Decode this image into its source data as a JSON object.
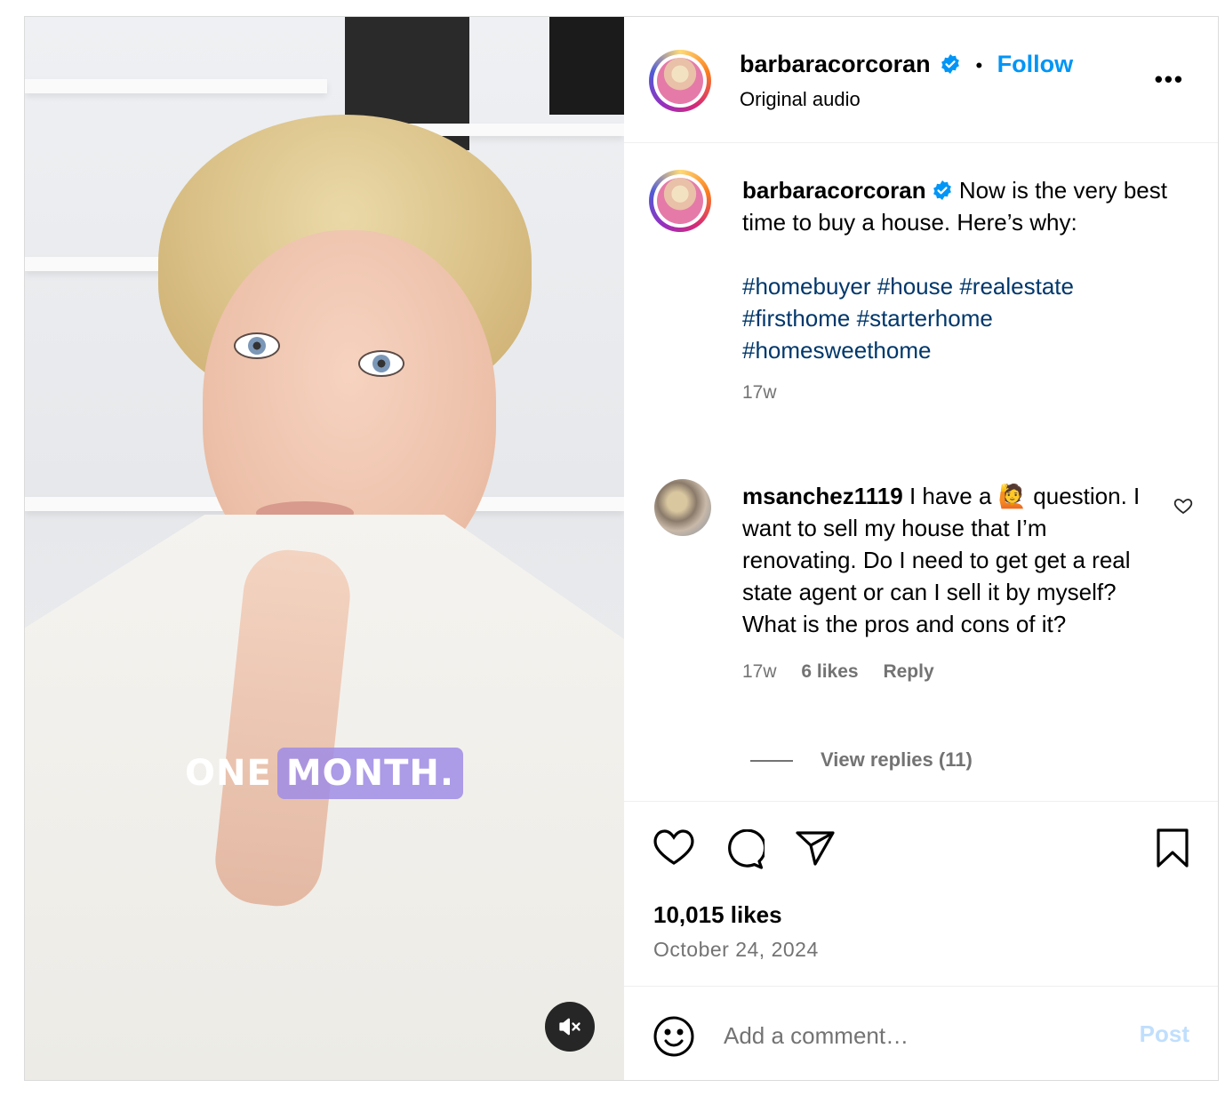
{
  "video": {
    "caption_plain": "ONE",
    "caption_highlight": "MONTH.",
    "mute_icon": "volume-muted-icon"
  },
  "header": {
    "username": "barbaracorcoran",
    "verified_icon": "verified-badge-icon",
    "separator": "•",
    "follow_label": "Follow",
    "audio": "Original audio",
    "more_icon": "more-options-icon",
    "more_glyph": "•••"
  },
  "caption": {
    "username": "barbaracorcoran",
    "text": "Now is the very best time to buy a house. Here’s why:",
    "hashtags": [
      "#homebuyer",
      "#house",
      "#realestate",
      "#firsthome",
      "#starterhome",
      "#homesweethome"
    ],
    "age": "17w"
  },
  "comment": {
    "username": "msanchez1119",
    "text_before_emoji": "I have a",
    "emoji": "🙋",
    "text_after_emoji": "question. I want to sell my house that I’m renovating. Do I need to get get a real state agent or can I sell it by myself? What is the pros and cons of it?",
    "age": "17w",
    "likes": "6 likes",
    "reply_label": "Reply",
    "view_replies": "View replies (11)",
    "like_icon": "heart-outline-icon"
  },
  "actions": {
    "like_icon": "heart-icon",
    "comment_icon": "comment-bubble-icon",
    "share_icon": "paper-plane-icon",
    "save_icon": "bookmark-icon",
    "likes_count": "10,015 likes",
    "date": "October 24, 2024"
  },
  "add_comment": {
    "emoji_icon": "smiley-icon",
    "placeholder": "Add a comment…",
    "post_label": "Post"
  },
  "colors": {
    "link_blue": "#0095f6",
    "hashtag_blue": "#00376b",
    "muted": "#737373",
    "post_disabled": "#c0dffd"
  }
}
